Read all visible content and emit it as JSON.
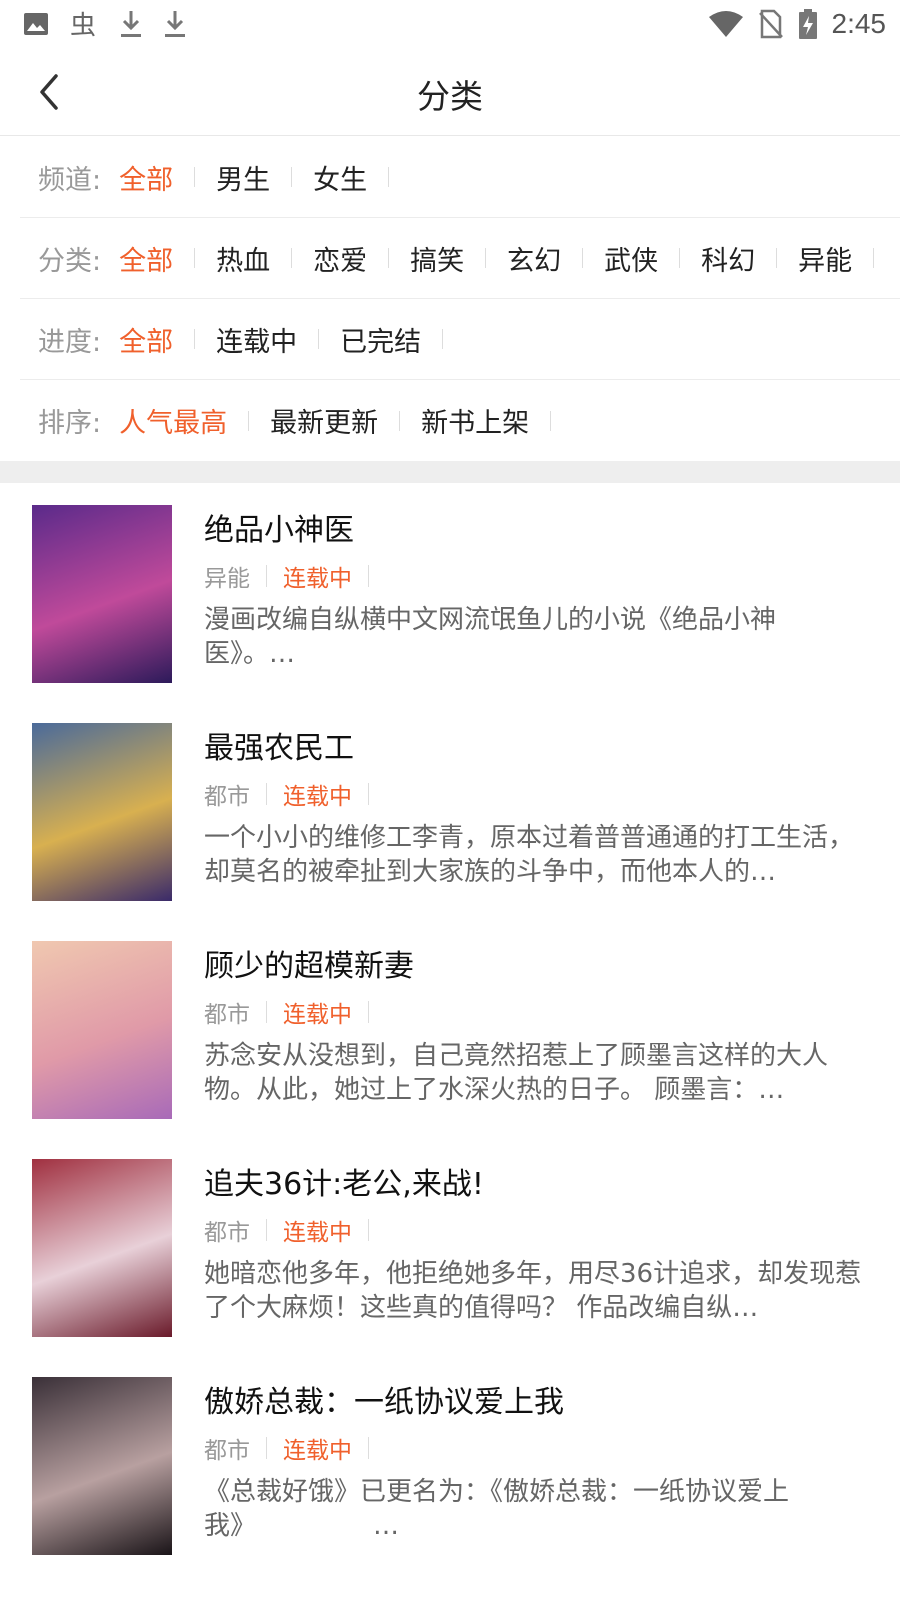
{
  "status_bar": {
    "time": "2:45",
    "left_icons": [
      "image-icon",
      "bug-icon",
      "download-icon",
      "download-icon"
    ],
    "right_icons": [
      "wifi-icon",
      "no-sim-icon",
      "battery-charging-icon"
    ]
  },
  "header": {
    "title": "分类",
    "back_icon": "chevron-left-icon"
  },
  "filters": {
    "channel": {
      "label": "频道:",
      "options": [
        "全部",
        "男生",
        "女生"
      ],
      "selected": "全部"
    },
    "category": {
      "label": "分类:",
      "options": [
        "全部",
        "热血",
        "恋爱",
        "搞笑",
        "玄幻",
        "武侠",
        "科幻",
        "异能"
      ],
      "selected": "全部"
    },
    "progress": {
      "label": "进度:",
      "options": [
        "全部",
        "连载中",
        "已完结"
      ],
      "selected": "全部"
    },
    "sort": {
      "label": "排序:",
      "options": [
        "人气最高",
        "最新更新",
        "新书上架"
      ],
      "selected": "人气最高"
    }
  },
  "colors": {
    "accent": "#f0602c",
    "label_gray": "#999999",
    "divider": "#eeeeee"
  },
  "comics": [
    {
      "title": "绝品小神医",
      "genre": "异能",
      "status": "连载中",
      "desc": "漫画改编自纵横中文网流氓鱼儿的小说《绝品小神医》。…",
      "cover_colors": [
        "#5a2a8a",
        "#c04a9a",
        "#2c1a5a"
      ]
    },
    {
      "title": "最强农民工",
      "genre": "都市",
      "status": "连载中",
      "desc": "一个小小的维修工李青，原本过着普普通通的打工生活，却莫名的被牵扯到大家族的斗争中，而他本人的…",
      "cover_colors": [
        "#4a6a9a",
        "#d8b050",
        "#3a2a6a"
      ]
    },
    {
      "title": "顾少的超模新妻",
      "genre": "都市",
      "status": "连载中",
      "desc": "苏念安从没想到，自己竟然招惹上了顾墨言这样的大人物。从此，她过上了水深火热的日子。 顾墨言：…",
      "cover_colors": [
        "#f0c8b0",
        "#e09aa8",
        "#a86ab8"
      ]
    },
    {
      "title": "追夫36计:老公,来战!",
      "genre": "都市",
      "status": "连载中",
      "desc": "她暗恋他多年，他拒绝她多年，用尽36计追求，却发现惹了个大麻烦！这些真的值得吗？ 作品改编自纵…",
      "cover_colors": [
        "#a03040",
        "#e8d0d8",
        "#6a1a2a"
      ]
    },
    {
      "title": "傲娇总裁：一纸协议爱上我",
      "genre": "都市",
      "status": "连载中",
      "desc": "《总裁好饿》已更名为：《傲娇总裁：一纸协议爱上我》　　　　　…",
      "cover_colors": [
        "#3a3038",
        "#b8a0a0",
        "#1a1418"
      ]
    }
  ]
}
